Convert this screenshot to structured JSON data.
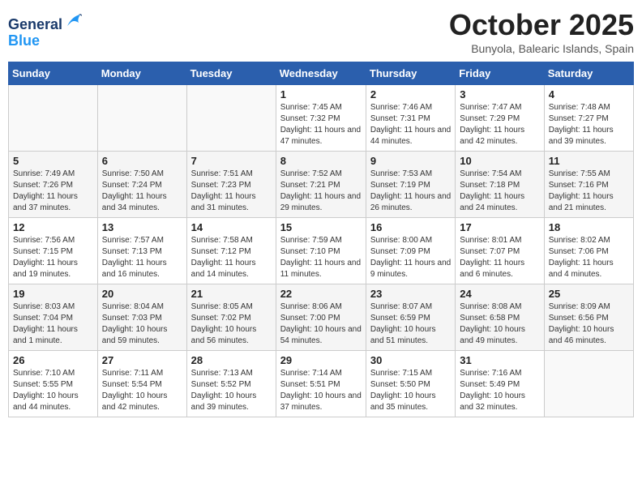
{
  "header": {
    "logo_line1": "General",
    "logo_line2": "Blue",
    "title": "October 2025",
    "subtitle": "Bunyola, Balearic Islands, Spain"
  },
  "weekdays": [
    "Sunday",
    "Monday",
    "Tuesday",
    "Wednesday",
    "Thursday",
    "Friday",
    "Saturday"
  ],
  "weeks": [
    [
      {
        "day": "",
        "info": ""
      },
      {
        "day": "",
        "info": ""
      },
      {
        "day": "",
        "info": ""
      },
      {
        "day": "1",
        "info": "Sunrise: 7:45 AM\nSunset: 7:32 PM\nDaylight: 11 hours and 47 minutes."
      },
      {
        "day": "2",
        "info": "Sunrise: 7:46 AM\nSunset: 7:31 PM\nDaylight: 11 hours and 44 minutes."
      },
      {
        "day": "3",
        "info": "Sunrise: 7:47 AM\nSunset: 7:29 PM\nDaylight: 11 hours and 42 minutes."
      },
      {
        "day": "4",
        "info": "Sunrise: 7:48 AM\nSunset: 7:27 PM\nDaylight: 11 hours and 39 minutes."
      }
    ],
    [
      {
        "day": "5",
        "info": "Sunrise: 7:49 AM\nSunset: 7:26 PM\nDaylight: 11 hours and 37 minutes."
      },
      {
        "day": "6",
        "info": "Sunrise: 7:50 AM\nSunset: 7:24 PM\nDaylight: 11 hours and 34 minutes."
      },
      {
        "day": "7",
        "info": "Sunrise: 7:51 AM\nSunset: 7:23 PM\nDaylight: 11 hours and 31 minutes."
      },
      {
        "day": "8",
        "info": "Sunrise: 7:52 AM\nSunset: 7:21 PM\nDaylight: 11 hours and 29 minutes."
      },
      {
        "day": "9",
        "info": "Sunrise: 7:53 AM\nSunset: 7:19 PM\nDaylight: 11 hours and 26 minutes."
      },
      {
        "day": "10",
        "info": "Sunrise: 7:54 AM\nSunset: 7:18 PM\nDaylight: 11 hours and 24 minutes."
      },
      {
        "day": "11",
        "info": "Sunrise: 7:55 AM\nSunset: 7:16 PM\nDaylight: 11 hours and 21 minutes."
      }
    ],
    [
      {
        "day": "12",
        "info": "Sunrise: 7:56 AM\nSunset: 7:15 PM\nDaylight: 11 hours and 19 minutes."
      },
      {
        "day": "13",
        "info": "Sunrise: 7:57 AM\nSunset: 7:13 PM\nDaylight: 11 hours and 16 minutes."
      },
      {
        "day": "14",
        "info": "Sunrise: 7:58 AM\nSunset: 7:12 PM\nDaylight: 11 hours and 14 minutes."
      },
      {
        "day": "15",
        "info": "Sunrise: 7:59 AM\nSunset: 7:10 PM\nDaylight: 11 hours and 11 minutes."
      },
      {
        "day": "16",
        "info": "Sunrise: 8:00 AM\nSunset: 7:09 PM\nDaylight: 11 hours and 9 minutes."
      },
      {
        "day": "17",
        "info": "Sunrise: 8:01 AM\nSunset: 7:07 PM\nDaylight: 11 hours and 6 minutes."
      },
      {
        "day": "18",
        "info": "Sunrise: 8:02 AM\nSunset: 7:06 PM\nDaylight: 11 hours and 4 minutes."
      }
    ],
    [
      {
        "day": "19",
        "info": "Sunrise: 8:03 AM\nSunset: 7:04 PM\nDaylight: 11 hours and 1 minute."
      },
      {
        "day": "20",
        "info": "Sunrise: 8:04 AM\nSunset: 7:03 PM\nDaylight: 10 hours and 59 minutes."
      },
      {
        "day": "21",
        "info": "Sunrise: 8:05 AM\nSunset: 7:02 PM\nDaylight: 10 hours and 56 minutes."
      },
      {
        "day": "22",
        "info": "Sunrise: 8:06 AM\nSunset: 7:00 PM\nDaylight: 10 hours and 54 minutes."
      },
      {
        "day": "23",
        "info": "Sunrise: 8:07 AM\nSunset: 6:59 PM\nDaylight: 10 hours and 51 minutes."
      },
      {
        "day": "24",
        "info": "Sunrise: 8:08 AM\nSunset: 6:58 PM\nDaylight: 10 hours and 49 minutes."
      },
      {
        "day": "25",
        "info": "Sunrise: 8:09 AM\nSunset: 6:56 PM\nDaylight: 10 hours and 46 minutes."
      }
    ],
    [
      {
        "day": "26",
        "info": "Sunrise: 7:10 AM\nSunset: 5:55 PM\nDaylight: 10 hours and 44 minutes."
      },
      {
        "day": "27",
        "info": "Sunrise: 7:11 AM\nSunset: 5:54 PM\nDaylight: 10 hours and 42 minutes."
      },
      {
        "day": "28",
        "info": "Sunrise: 7:13 AM\nSunset: 5:52 PM\nDaylight: 10 hours and 39 minutes."
      },
      {
        "day": "29",
        "info": "Sunrise: 7:14 AM\nSunset: 5:51 PM\nDaylight: 10 hours and 37 minutes."
      },
      {
        "day": "30",
        "info": "Sunrise: 7:15 AM\nSunset: 5:50 PM\nDaylight: 10 hours and 35 minutes."
      },
      {
        "day": "31",
        "info": "Sunrise: 7:16 AM\nSunset: 5:49 PM\nDaylight: 10 hours and 32 minutes."
      },
      {
        "day": "",
        "info": ""
      }
    ]
  ]
}
